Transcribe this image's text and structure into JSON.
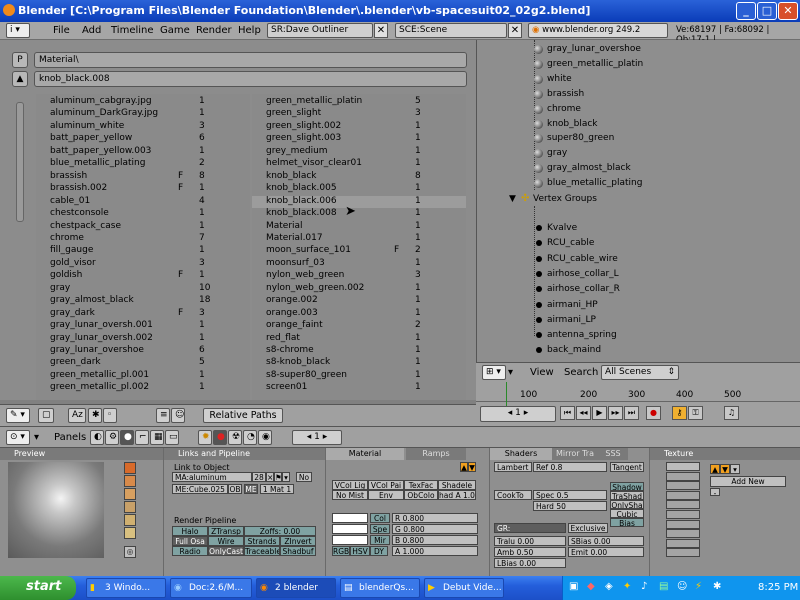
{
  "window": {
    "title": "Blender [C:\\Program Files\\Blender Foundation\\Blender\\.blender\\vb-spacesuit02_02g2.blend]"
  },
  "menubar": {
    "items": [
      "File",
      "Add",
      "Timeline",
      "Game",
      "Render",
      "Help"
    ],
    "screen": "SR:Dave Outliner",
    "scene": "SCE:Scene",
    "url": "www.blender.org 249.2",
    "stats": "Ve:68197 | Fa:68092 | Ob:17-1 |"
  },
  "oops": {
    "path_button": "P",
    "path": "Material\\",
    "filter": "knob_black.008",
    "col1": [
      [
        "aluminum_cabgray.jpg",
        "",
        "1"
      ],
      [
        "aluminum_DarkGray.jpg",
        "",
        "1"
      ],
      [
        "aluminum_white",
        "",
        "3"
      ],
      [
        "batt_paper_yellow",
        "",
        "6"
      ],
      [
        "batt_paper_yellow.003",
        "",
        "1"
      ],
      [
        "blue_metallic_plating",
        "",
        "2"
      ],
      [
        "brassish",
        "F",
        "8"
      ],
      [
        "brassish.002",
        "F",
        "1"
      ],
      [
        "cable_01",
        "",
        "4"
      ],
      [
        "chestconsole",
        "",
        "1"
      ],
      [
        "chestpack_case",
        "",
        "1"
      ],
      [
        "chrome",
        "",
        "7"
      ],
      [
        "fill_gauge",
        "",
        "1"
      ],
      [
        "gold_visor",
        "",
        "3"
      ],
      [
        "goldish",
        "F",
        "1"
      ],
      [
        "gray",
        "",
        "10"
      ],
      [
        "gray_almost_black",
        "",
        "18"
      ],
      [
        "gray_dark",
        "F",
        "3"
      ],
      [
        "gray_lunar_oversh.001",
        "",
        "1"
      ],
      [
        "gray_lunar_oversh.002",
        "",
        "1"
      ],
      [
        "gray_lunar_overshoe",
        "",
        "6"
      ],
      [
        "green_dark",
        "",
        "5"
      ],
      [
        "green_metallic_pl.001",
        "",
        "1"
      ],
      [
        "green_metallic_pl.002",
        "",
        "1"
      ]
    ],
    "col2": [
      [
        "green_metallic_platin",
        "",
        "5"
      ],
      [
        "green_slight",
        "",
        "3"
      ],
      [
        "green_slight.002",
        "",
        "1"
      ],
      [
        "green_slight.003",
        "",
        "1"
      ],
      [
        "grey_medium",
        "",
        "1"
      ],
      [
        "helmet_visor_clear01",
        "",
        "1"
      ],
      [
        "knob_black",
        "",
        "8"
      ],
      [
        "knob_black.005",
        "",
        "1"
      ],
      [
        "knob_black.006",
        "",
        "1"
      ],
      [
        "knob_black.008",
        "",
        "1"
      ],
      [
        "Material",
        "",
        "1"
      ],
      [
        "Material.017",
        "",
        "1"
      ],
      [
        "moon_surface_101",
        "F",
        "2"
      ],
      [
        "moonsurf_03",
        "",
        "1"
      ],
      [
        "nylon_web_green",
        "",
        "3"
      ],
      [
        "nylon_web_green.002",
        "",
        "1"
      ],
      [
        "orange.002",
        "",
        "1"
      ],
      [
        "orange.003",
        "",
        "1"
      ],
      [
        "orange_faint",
        "",
        "2"
      ],
      [
        "red_flat",
        "",
        "1"
      ],
      [
        "s8-chrome",
        "",
        "1"
      ],
      [
        "s8-knob_black",
        "",
        "1"
      ],
      [
        "s8-super80_green",
        "",
        "1"
      ],
      [
        "screen01",
        "",
        "1"
      ]
    ],
    "footer": {
      "relative_paths": "Relative Paths"
    }
  },
  "outliner": {
    "materials": [
      "gray_lunar_overshoe",
      "green_metallic_platin",
      "white",
      "brassish",
      "chrome",
      "knob_black",
      "super80_green",
      "gray",
      "gray_almost_black",
      "blue_metallic_plating"
    ],
    "vertex_groups_label": "Vertex Groups",
    "vertex_groups": [
      "Kvalve",
      "RCU_cable",
      "RCU_cable_wire",
      "airhose_collar_L",
      "airhose_collar_R",
      "airmani_HP",
      "airmani_LP",
      "antenna_spring",
      "back_maind"
    ],
    "header": {
      "view": "View",
      "search": "Search",
      "scenes": "All Scenes"
    }
  },
  "timeline": {
    "ticks": [
      "100",
      "200",
      "300",
      "400",
      "500"
    ],
    "frame": "1"
  },
  "buttons": {
    "panels_label": "Panels",
    "frame": "1",
    "preview": {
      "title": "Preview"
    },
    "links": {
      "title": "Links and Pipeline",
      "link_to_object": "Link to Object",
      "ma": "MA:aluminum",
      "ma_users": "28",
      "no": "No",
      "me": "ME:Cube.025",
      "ob": "OB",
      "me_btn": "ME",
      "mat": "1 Mat 1",
      "render_pipeline": "Render Pipeline",
      "rp": [
        [
          "Halo",
          "ZTransp",
          "Zoffs: 0.00"
        ],
        [
          "Full Osa",
          "Wire",
          "Strands",
          "ZInvert"
        ],
        [
          "Radio",
          "OnlyCast",
          "Traceable",
          "Shadbuf"
        ]
      ]
    },
    "material": {
      "tab_material": "Material",
      "tab_ramps": "Ramps",
      "row1": [
        "VCol Lig",
        "VCol Pai",
        "TexFac",
        "Shadele"
      ],
      "row2": [
        "No Mist",
        "Env",
        "ObColo",
        "had A 1.00"
      ],
      "col": "Col",
      "spe": "Spe",
      "mir": "Mir",
      "r": "R 0.800",
      "g": "G 0.800",
      "b": "B 0.800",
      "modes": [
        "RGB",
        "HSV",
        "DY"
      ],
      "a": "A 1.000"
    },
    "shaders": {
      "tab_shaders": "Shaders",
      "tab_mirror": "Mirror Tra",
      "tab_sss": "SSS",
      "lambert": "Lambert",
      "ref": "Ref  0.8",
      "tangent": "Tangent",
      "cooktorr": "CookTo",
      "spec": "Spec 0.5",
      "hard": "Hard 50",
      "opts": [
        "Shadow",
        "TraShad",
        "OnlySha",
        "Cubic",
        "Bias"
      ],
      "gr": "GR:",
      "exclusive": "Exclusive",
      "tralu": "Tralu 0.00",
      "sbias": "SBias 0.00",
      "amb": "Amb 0.50",
      "emit": "Emit 0.00",
      "lbias": "LBias 0.00"
    },
    "texture": {
      "title": "Texture",
      "add_new": "Add New"
    }
  },
  "taskbar": {
    "start": "start",
    "tasks": [
      "3 Windo...",
      "Doc:2.6/M...",
      "2 blender",
      "blenderQs...",
      "Debut Vide..."
    ],
    "clock": "8:25 PM"
  }
}
